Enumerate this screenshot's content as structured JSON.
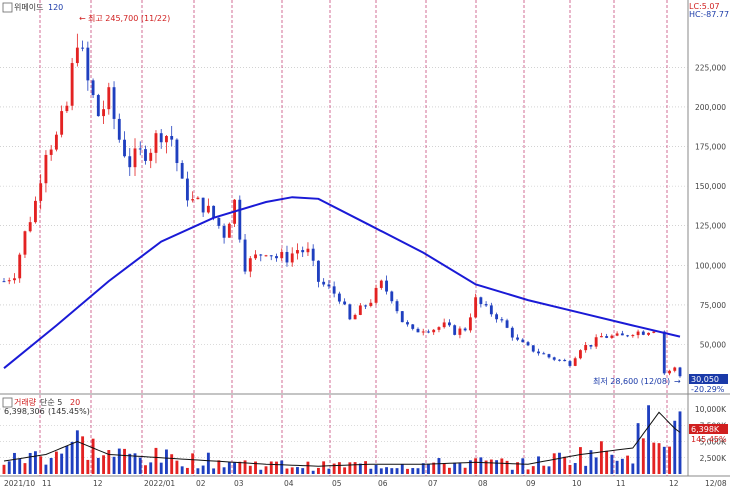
{
  "header": {
    "title": "위메이드",
    "ma_period": "120",
    "lc_label": "LC:5.07",
    "hc_label": "HC:-87.77"
  },
  "annotations": {
    "high_label": "최고 245,700 (11/22)",
    "low_label": "최저 28,600 (12/08)",
    "current_price": "30,050",
    "current_change": "-20.29%"
  },
  "volume_panel": {
    "title": "거래량",
    "ma_label": "단순 5",
    "ma2": "20",
    "info": "6,398,306",
    "info_pct": "(145.45%)",
    "current_volume": "6,398K",
    "current_pct": "145.45%"
  },
  "colors": {
    "up": "#e32222",
    "down": "#1f3fbf",
    "ma_line": "#1a1ad6",
    "vline": "#c0306a",
    "grid": "#b8b8b8",
    "price_box": "#1a3aa8",
    "vol_box": "#d01f1f"
  },
  "chart_data": {
    "type": "candlestick",
    "price_axis_ticks": [
      "225,000",
      "200,000",
      "175,000",
      "150,000",
      "125,000",
      "100,000",
      "75,000",
      "50,000"
    ],
    "price_tick_values": [
      225000,
      200000,
      175000,
      150000,
      125000,
      100000,
      75000,
      50000
    ],
    "ylim": [
      20000,
      265000
    ],
    "volume_axis_ticks": [
      "10,000K",
      "7,500K",
      "5,000K",
      "2,500K"
    ],
    "volume_tick_values": [
      10000000,
      7500000,
      5000000,
      2500000
    ],
    "volume_ylim": [
      0,
      12000000
    ],
    "x_labels": [
      "2021/10",
      "11",
      "12",
      "2022/01",
      "02",
      "03",
      "04",
      "05",
      "06",
      "07",
      "08",
      "09",
      "10",
      "11",
      "12",
      "12/08"
    ],
    "close_path": [
      [
        0,
        90000
      ],
      [
        2,
        95000
      ],
      [
        4,
        120000
      ],
      [
        6,
        140000
      ],
      [
        8,
        175000
      ],
      [
        10,
        180000
      ],
      [
        12,
        200000
      ],
      [
        14,
        245700
      ],
      [
        16,
        215000
      ],
      [
        18,
        195000
      ],
      [
        20,
        205000
      ],
      [
        22,
        180000
      ],
      [
        24,
        165000
      ],
      [
        26,
        170000
      ],
      [
        28,
        175000
      ],
      [
        30,
        185000
      ],
      [
        32,
        180000
      ],
      [
        34,
        150000
      ],
      [
        36,
        140000
      ],
      [
        38,
        138000
      ],
      [
        40,
        130000
      ],
      [
        42,
        120000
      ],
      [
        44,
        140000
      ],
      [
        46,
        100000
      ],
      [
        48,
        105000
      ],
      [
        50,
        110000
      ],
      [
        52,
        105000
      ],
      [
        54,
        105000
      ],
      [
        56,
        110000
      ],
      [
        58,
        108000
      ],
      [
        60,
        90000
      ],
      [
        62,
        85000
      ],
      [
        64,
        80000
      ],
      [
        66,
        65000
      ],
      [
        68,
        72000
      ],
      [
        70,
        78000
      ],
      [
        72,
        88000
      ],
      [
        74,
        80000
      ],
      [
        76,
        65000
      ],
      [
        78,
        58000
      ],
      [
        80,
        60000
      ],
      [
        82,
        60000
      ],
      [
        84,
        62000
      ],
      [
        86,
        58000
      ],
      [
        88,
        60000
      ],
      [
        90,
        78000
      ],
      [
        92,
        72000
      ],
      [
        94,
        68000
      ],
      [
        96,
        60000
      ],
      [
        98,
        52000
      ],
      [
        100,
        48000
      ],
      [
        102,
        45000
      ],
      [
        104,
        42000
      ],
      [
        106,
        40000
      ],
      [
        108,
        38000
      ],
      [
        110,
        48000
      ],
      [
        112,
        50000
      ],
      [
        114,
        55000
      ],
      [
        116,
        55000
      ],
      [
        118,
        55000
      ],
      [
        120,
        58000
      ],
      [
        122,
        58000
      ],
      [
        124,
        60000
      ],
      [
        126,
        32000
      ],
      [
        128,
        35000
      ],
      [
        129,
        30050
      ]
    ],
    "ma120": [
      [
        0,
        35000
      ],
      [
        10,
        62000
      ],
      [
        20,
        90000
      ],
      [
        30,
        115000
      ],
      [
        40,
        130000
      ],
      [
        50,
        140000
      ],
      [
        55,
        143000
      ],
      [
        60,
        142000
      ],
      [
        70,
        125000
      ],
      [
        80,
        108000
      ],
      [
        90,
        88000
      ],
      [
        100,
        78000
      ],
      [
        110,
        70000
      ],
      [
        120,
        62000
      ],
      [
        129,
        55000
      ]
    ],
    "volume_profile": [
      [
        0,
        2000000
      ],
      [
        8,
        3000000
      ],
      [
        14,
        5000000
      ],
      [
        20,
        3000000
      ],
      [
        30,
        2500000
      ],
      [
        40,
        2000000
      ],
      [
        50,
        1500000
      ],
      [
        60,
        1200000
      ],
      [
        70,
        1500000
      ],
      [
        80,
        1500000
      ],
      [
        90,
        1800000
      ],
      [
        100,
        1500000
      ],
      [
        110,
        3000000
      ],
      [
        120,
        4000000
      ],
      [
        125,
        9500000
      ],
      [
        128,
        7000000
      ],
      [
        129,
        6398306
      ]
    ],
    "grid": true
  }
}
